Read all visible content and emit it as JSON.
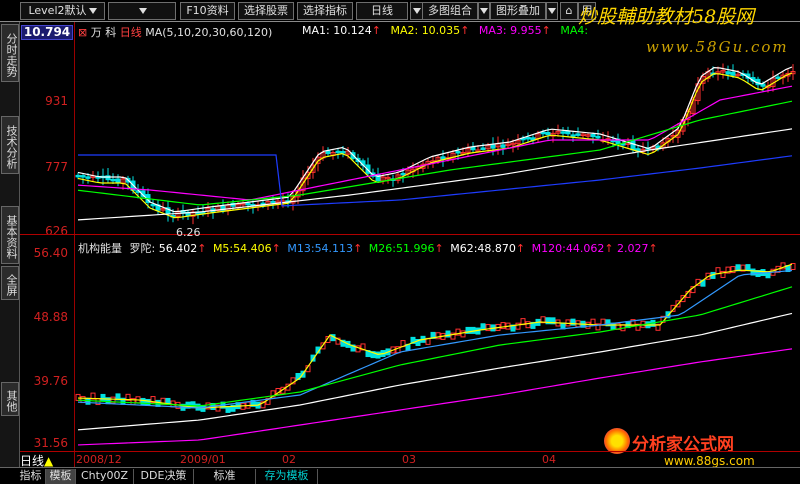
{
  "toolbar": {
    "level2": "Level2默认",
    "f10": "F10资料",
    "select_stock": "选择股票",
    "select_indicator": "选择指标",
    "daily": "日线",
    "multi_combo": "多图组合",
    "overlay": "图形叠加",
    "extra": "用"
  },
  "brand": {
    "title": "炒股輔助教材58股网",
    "url": "www.58Gu.com"
  },
  "watermark": {
    "title": "分析家公式网",
    "url": "www.88gs.com"
  },
  "sidebar": {
    "tabs": [
      "分时走势",
      "技术分析",
      "基本资料",
      "全屏",
      "其他"
    ]
  },
  "price_panel": {
    "current_price": "10.794",
    "axis_labels": [
      "931",
      "777",
      "626"
    ],
    "stock_name": "万 科",
    "period": "日线",
    "ma_params": "MA(5,10,20,30,60,120)",
    "ma_values": [
      {
        "label": "MA1:",
        "value": "10.124",
        "color": "#ffffff"
      },
      {
        "label": "MA2:",
        "value": "10.035",
        "color": "#ffff00"
      },
      {
        "label": "MA3:",
        "value": "9.955",
        "color": "#ff00ff"
      },
      {
        "label": "MA4:",
        "value": "",
        "color": "#00ff00"
      }
    ],
    "low_marker": "6.26"
  },
  "indicator_panel": {
    "title": "机构能量",
    "name": "罗陀:",
    "axis_labels": [
      "56.40",
      "48.88",
      "39.76",
      "31.56"
    ],
    "values": [
      {
        "label": "",
        "value": "56.402",
        "color": "#ffffff"
      },
      {
        "label": "M5:",
        "value": "54.406",
        "color": "#ffff00"
      },
      {
        "label": "M13:",
        "value": "54.113",
        "color": "#3399ff"
      },
      {
        "label": "M26:",
        "value": "51.996",
        "color": "#00ff00"
      },
      {
        "label": "M62:",
        "value": "48.870",
        "color": "#ffffff"
      },
      {
        "label": "M120:",
        "value": "44.062",
        "color": "#ff00ff"
      },
      {
        "label": "",
        "value": "2.027",
        "color": "#ff00ff"
      }
    ]
  },
  "date_bar": {
    "period": "日线",
    "dates": [
      "2008/12",
      "2009/01",
      "02",
      "03",
      "04"
    ]
  },
  "bottom_tabs": [
    "指标",
    "模板",
    "Chty00Z",
    "DDE决策",
    "标准",
    "存为模板"
  ],
  "colors": {
    "up": "#ff3030",
    "down": "#00e0e0",
    "axis": "#d02020",
    "ma5": "#ffffff",
    "ma10": "#ffff00",
    "ma20": "#ff00ff",
    "ma30": "#00ff00",
    "ma60": "#ffffff",
    "ma120": "#1e3cff"
  }
}
